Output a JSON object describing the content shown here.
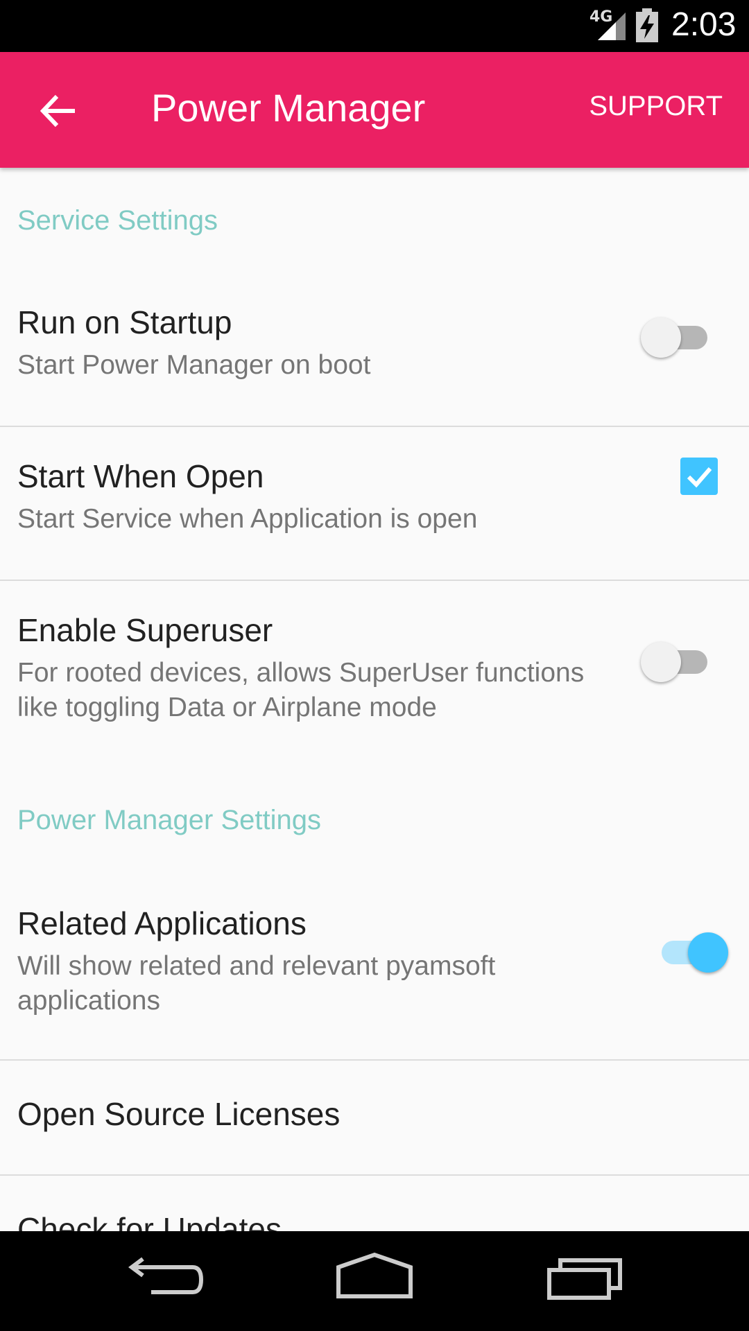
{
  "status_bar": {
    "network": "4G",
    "time": "2:03",
    "icons": [
      "signal-icon",
      "battery-charging-icon"
    ]
  },
  "app_bar": {
    "back_icon": "arrow-back-icon",
    "title": "Power Manager",
    "action_label": "SUPPORT",
    "color": "#eb2063"
  },
  "sections": [
    {
      "header": "Service Settings",
      "items": [
        {
          "title": "Run on Startup",
          "summary": "Start Power Manager on boot",
          "widget": "switch",
          "checked": false
        },
        {
          "title": "Start When Open",
          "summary": "Start Service when Application is open",
          "widget": "checkbox",
          "checked": true
        },
        {
          "title": "Enable Superuser",
          "summary": "For rooted devices, allows SuperUser functions like toggling Data or Airplane mode",
          "widget": "switch",
          "checked": false
        }
      ]
    },
    {
      "header": "Power Manager Settings",
      "items": [
        {
          "title": "Related Applications",
          "summary": "Will show related and relevant pyamsoft applications",
          "widget": "switch",
          "checked": true
        },
        {
          "title": "Open Source Licenses"
        },
        {
          "title": "Check for Updates"
        }
      ]
    }
  ],
  "colors": {
    "section_header": "#80cbc4",
    "accent": "#40c4ff"
  },
  "nav_bar": {
    "icons": [
      "nav-back-icon",
      "nav-home-icon",
      "nav-recents-icon"
    ]
  }
}
